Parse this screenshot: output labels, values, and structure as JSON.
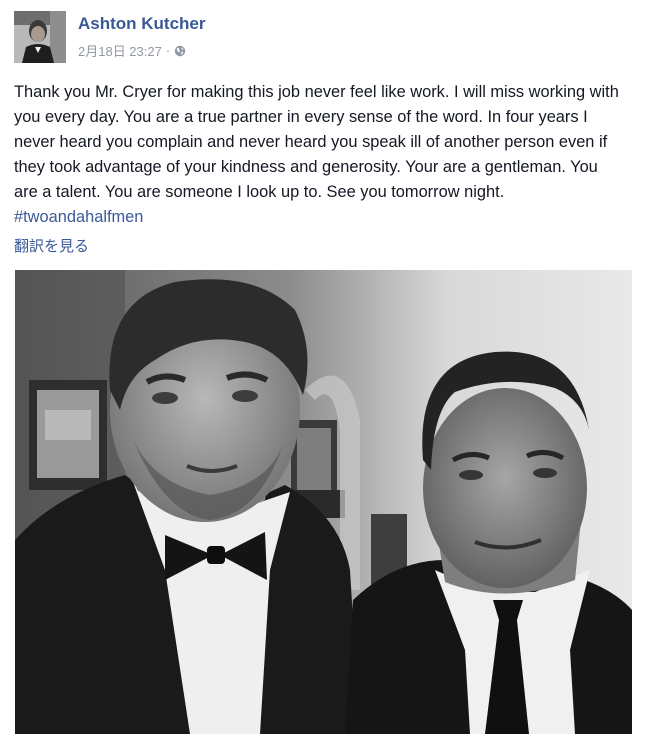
{
  "post": {
    "author": "Ashton Kutcher",
    "timestamp": "2月18日 23:27",
    "separator": "·",
    "privacy_icon": "globe-icon",
    "text": "Thank you Mr. Cryer for making this job never feel like work. I will miss working with you every day. You are a true partner in every sense of the word. In four years I never heard you complain and never heard you speak ill of another person even if they took advantage of your kindness and generosity. Your are a gentleman. You are a talent. You are someone I look up to. See you tomorrow night. ",
    "hashtag": "#twoandahalfmen",
    "translate_label": "翻訳を見る"
  },
  "colors": {
    "link": "#3b5998",
    "meta": "#9197a3",
    "text": "#141823"
  }
}
